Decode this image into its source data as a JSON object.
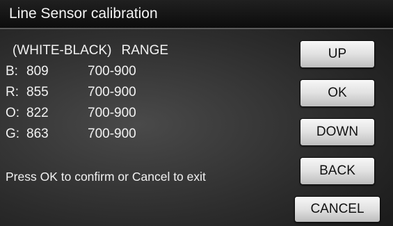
{
  "title": "Line Sensor calibration",
  "range_header": {
    "left": "(WHITE-BLACK)",
    "right": "RANGE"
  },
  "readings": [
    {
      "label": "B:",
      "value": "809",
      "range": "700-900"
    },
    {
      "label": "R:",
      "value": "855",
      "range": "700-900"
    },
    {
      "label": "O:",
      "value": "822",
      "range": "700-900"
    },
    {
      "label": "G:",
      "value": "863",
      "range": "700-900"
    }
  ],
  "message": "Press OK to confirm or Cancel to exit",
  "buttons": {
    "up": "UP",
    "ok": "OK",
    "down": "DOWN",
    "back": "BACK",
    "cancel": "CANCEL"
  }
}
